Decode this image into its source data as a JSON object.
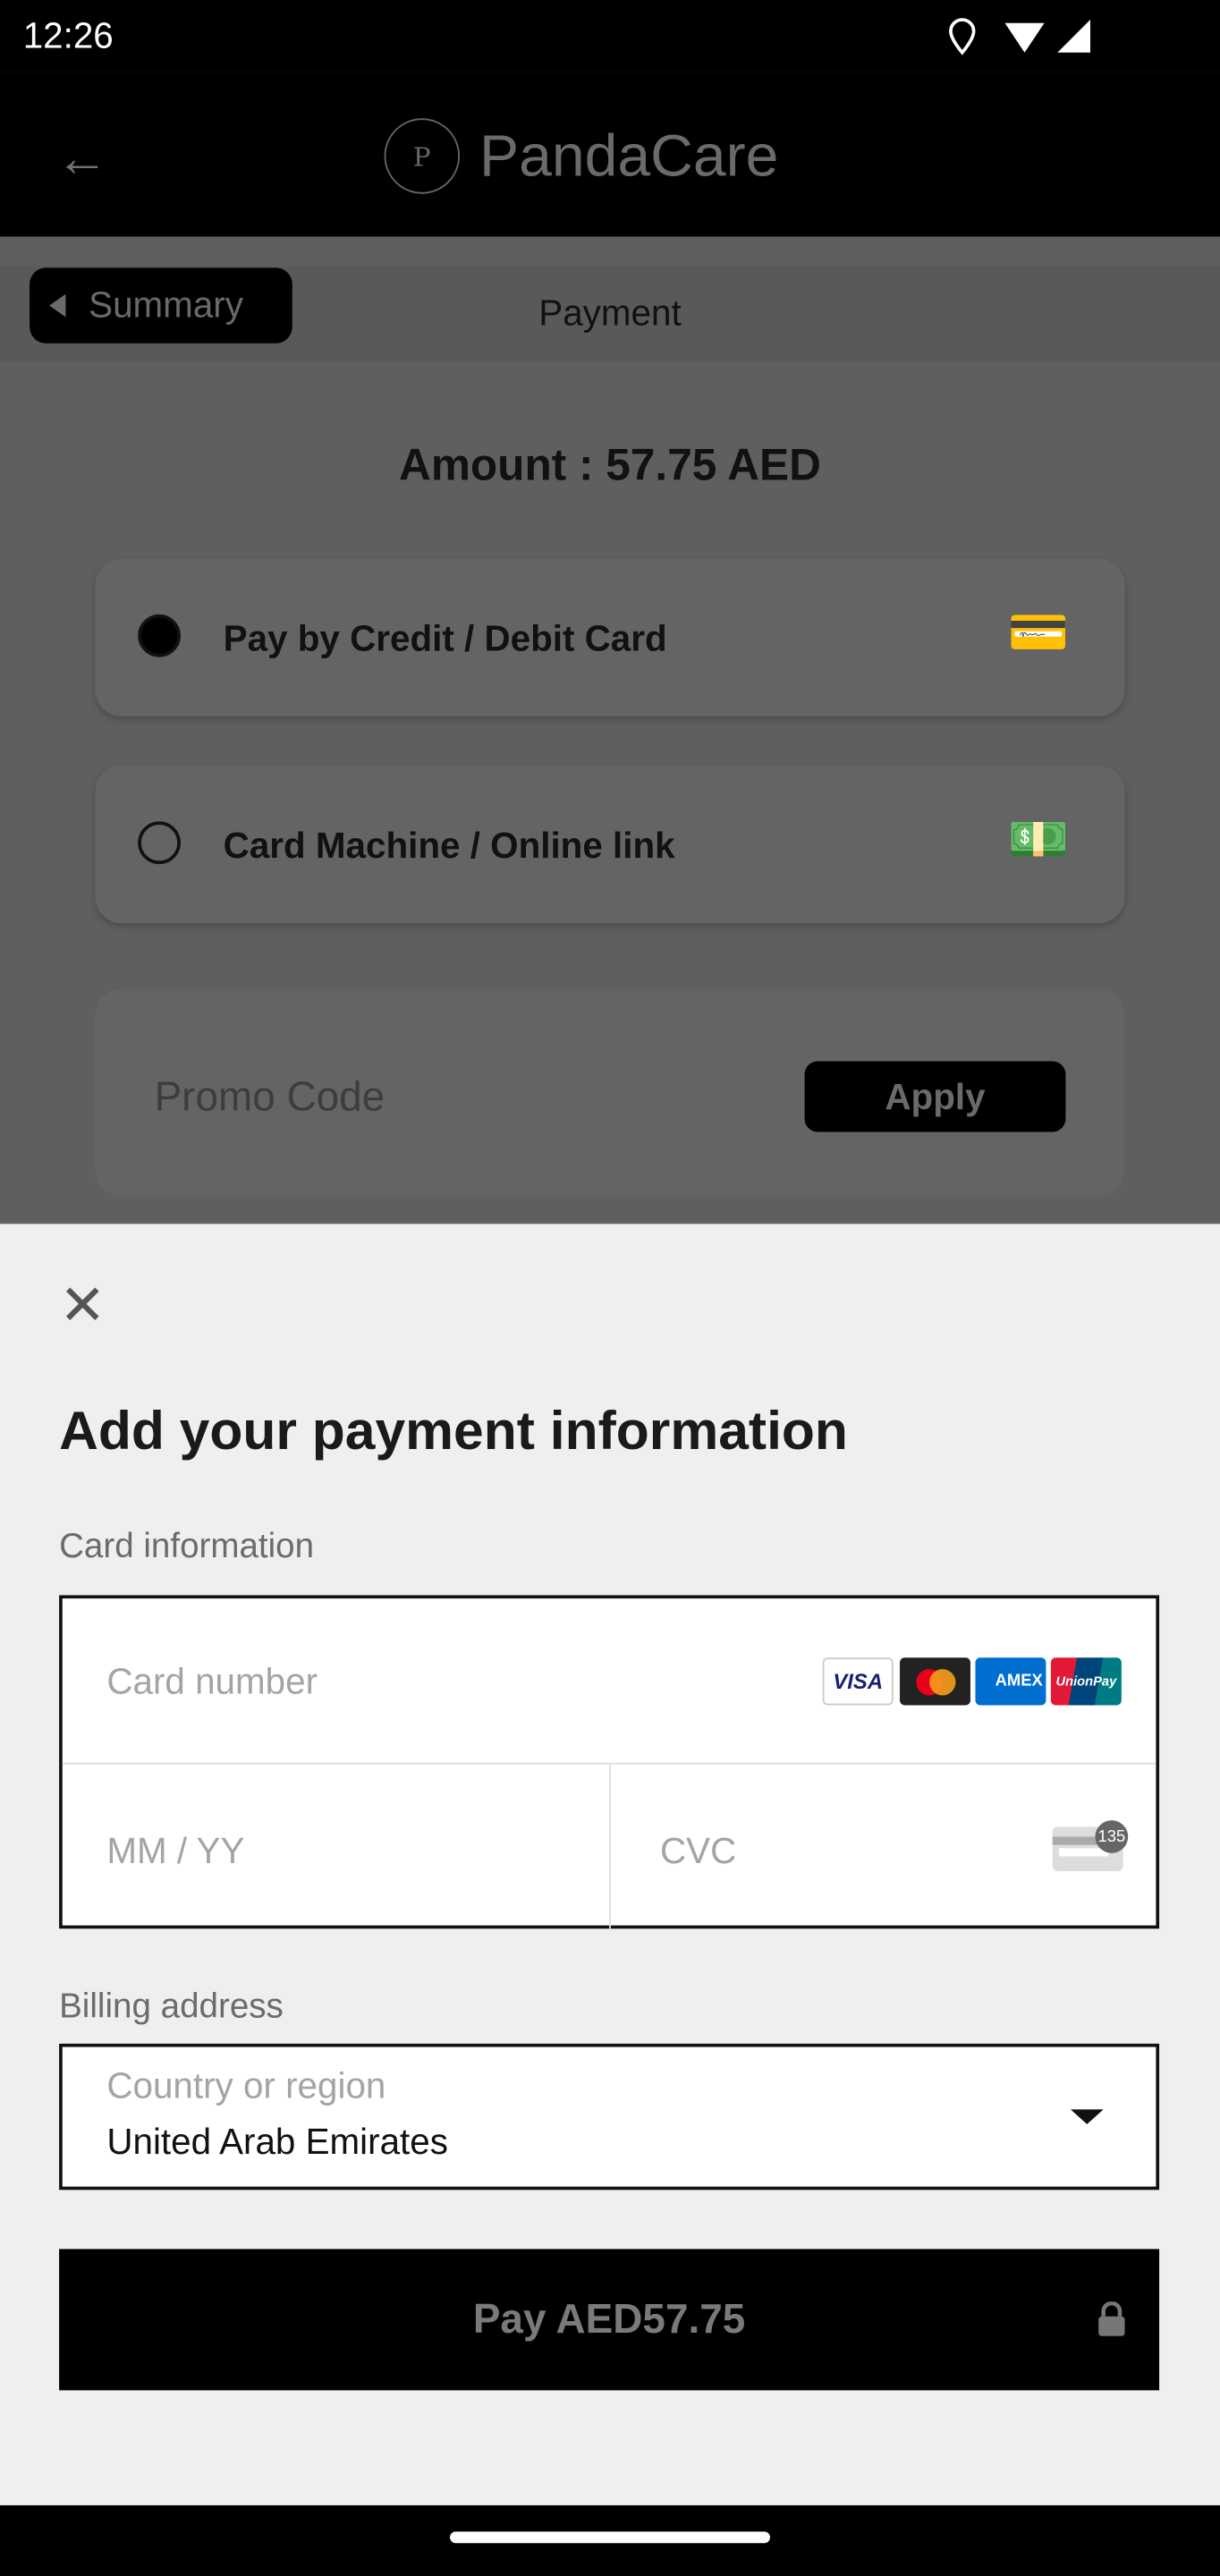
{
  "status_bar": {
    "time": "12:26",
    "icons": [
      "location-icon",
      "wifi-icon",
      "signal-icon"
    ]
  },
  "app_bar": {
    "brand": "PandaCare",
    "logo_letter": "P"
  },
  "subbar": {
    "back_label": "Summary",
    "title": "Payment"
  },
  "amount": "Amount : 57.75 AED",
  "payment_options": [
    {
      "label": "Pay by Credit / Debit Card",
      "selected": true,
      "icon": "credit-card-icon"
    },
    {
      "label": "Card Machine / Online link",
      "selected": false,
      "icon": "cash-icon"
    }
  ],
  "promo": {
    "placeholder": "Promo Code",
    "apply_label": "Apply"
  },
  "sheet": {
    "title": "Add your payment information",
    "card_section": "Card information",
    "card_number_placeholder": "Card number",
    "expiry_placeholder": "MM / YY",
    "cvc_placeholder": "CVC",
    "cvc_hint": "135",
    "card_brands": [
      "VISA",
      "Mastercard",
      "AMEX",
      "UnionPay"
    ],
    "billing_section": "Billing address",
    "country_label": "Country or region",
    "country_value": "United Arab Emirates",
    "pay_label": "Pay AED57.75"
  }
}
